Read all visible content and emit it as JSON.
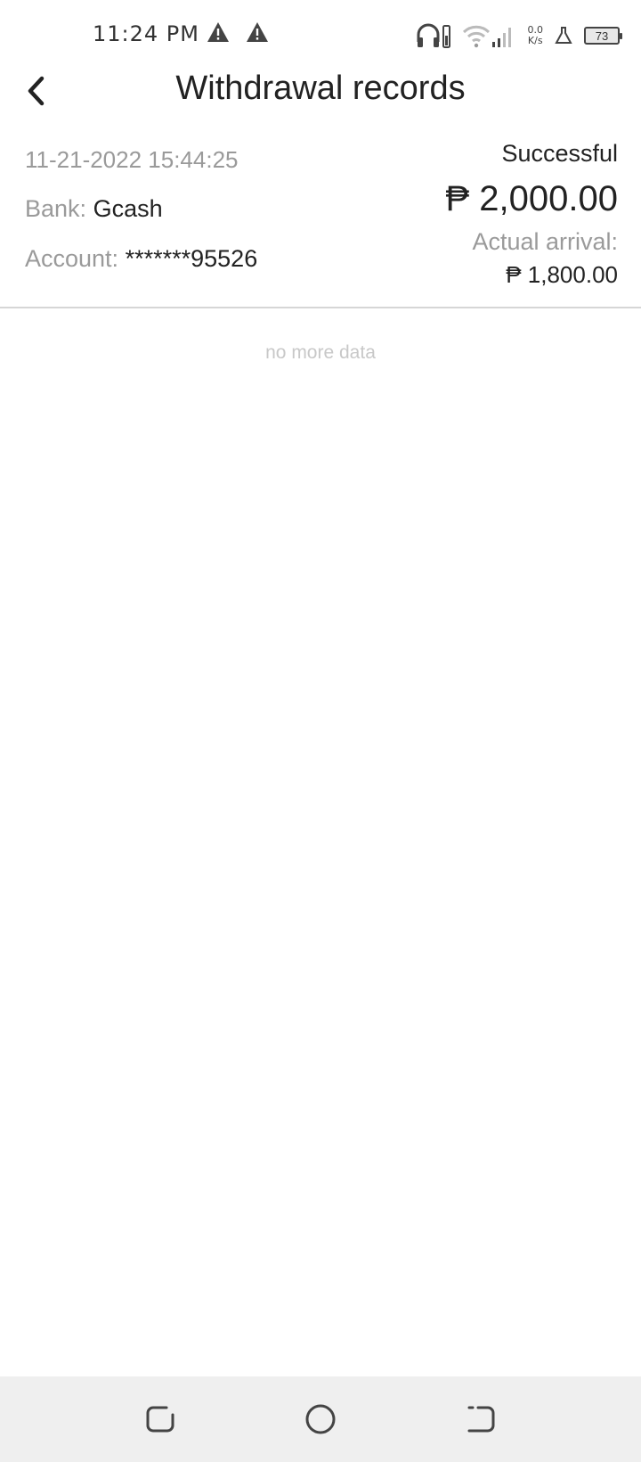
{
  "status_bar": {
    "time": "11:24 PM",
    "net_speed_value": "0.0",
    "net_speed_unit": "K/s",
    "battery": "73"
  },
  "header": {
    "title": "Withdrawal records"
  },
  "record": {
    "date": "11-21-2022 15:44:25",
    "bank_label": "Bank:",
    "bank_value": "Gcash",
    "account_label": "Account:",
    "account_value": "*******95526",
    "status": "Successful",
    "amount": "₱ 2,000.00",
    "arrival_label": "Actual arrival:",
    "arrival_amount": "₱ 1,800.00"
  },
  "list_footer": "no more data"
}
